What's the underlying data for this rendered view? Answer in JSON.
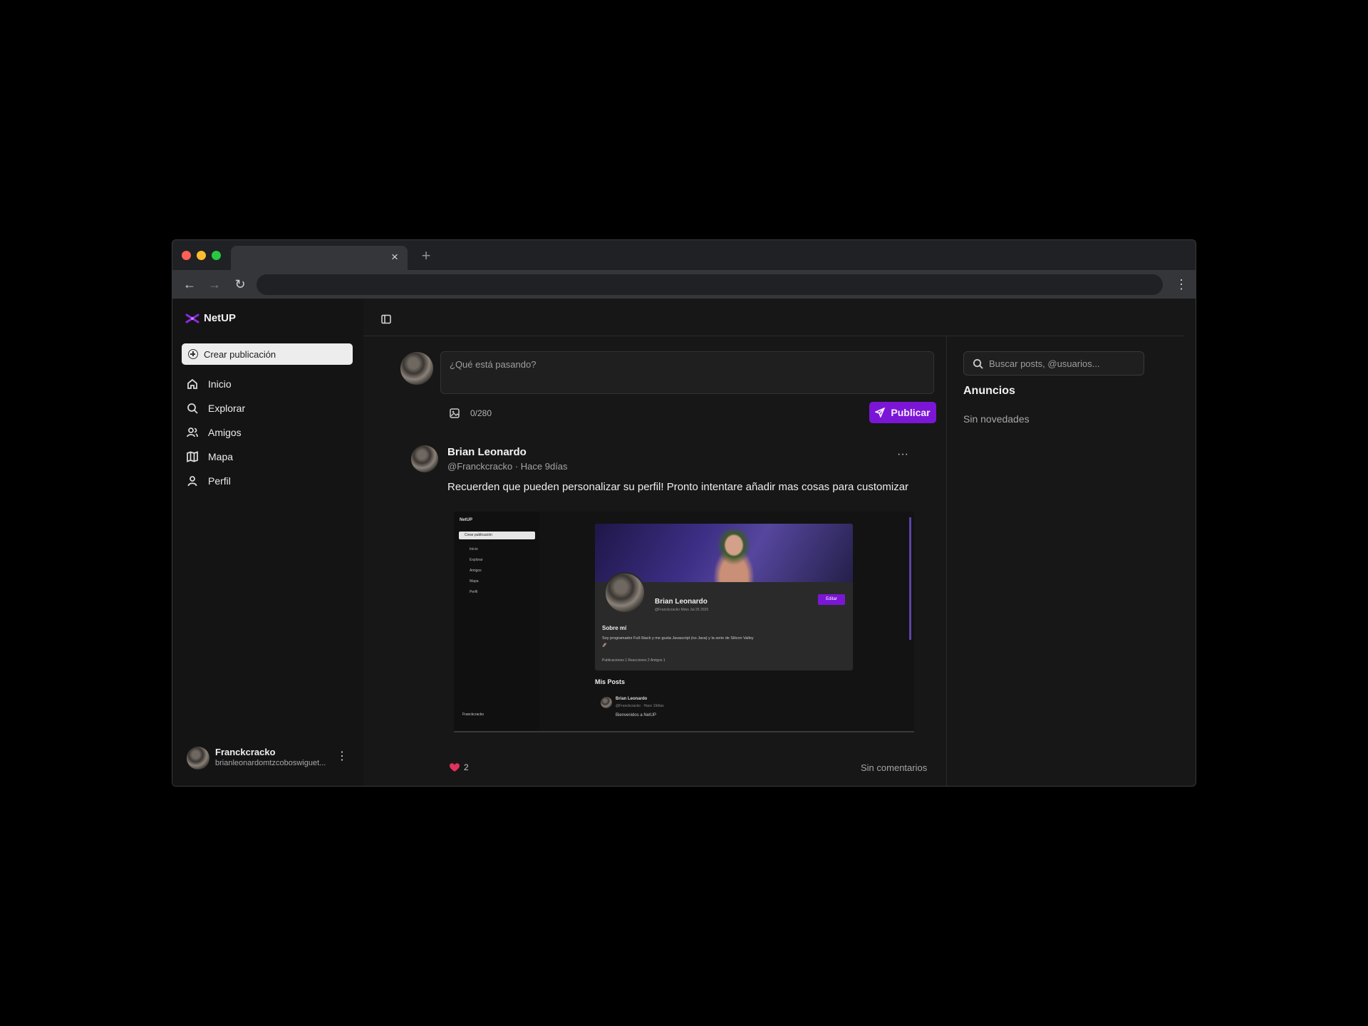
{
  "browser": {
    "tab_close": "×",
    "new_tab": "+",
    "menu": "⋮"
  },
  "sidebar": {
    "brand": "NetUP",
    "create_label": "Crear publicación",
    "items": [
      {
        "label": "Inicio",
        "icon": "home-icon"
      },
      {
        "label": "Explorar",
        "icon": "search-icon"
      },
      {
        "label": "Amigos",
        "icon": "users-icon"
      },
      {
        "label": "Mapa",
        "icon": "map-icon"
      },
      {
        "label": "Perfil",
        "icon": "user-icon"
      }
    ],
    "user": {
      "name": "Franckcracko",
      "email": "brianleonardomtzcoboswiguet..."
    }
  },
  "composer": {
    "placeholder": "¿Qué está pasando?",
    "char_count": "0/280",
    "publish_label": "Publicar"
  },
  "post": {
    "author": "Brian Leonardo",
    "meta": "@Franckcracko · Hace 9días",
    "more": "···",
    "text": "Recuerden que pueden personalizar su perfil! Pronto intentare añadir mas cosas para customizar",
    "likes": "2",
    "comments_label": "Sin comentarios",
    "image": {
      "brand": "NetUP",
      "create": "Crear publicación",
      "nav": [
        "Inicio",
        "Explorar",
        "Amigos",
        "Mapa",
        "Perfil"
      ],
      "user": "Franckcracko",
      "profile_name": "Brian Leonardo",
      "profile_handle": "@Franckcracko  Miws Jul 26 2025",
      "edit": "Editar",
      "about_title": "Sobre mí",
      "about_text": "Soy programador Full-Stack y me gusta Javascript (no Java) y la serie de Silicon Valley 🚀",
      "stats": "Publicaciones 1    Reacciones 2    Amigos 1",
      "section": "Mis Posts",
      "mini_post_name": "Brian Leonardo",
      "mini_post_meta": "@Franckcracko · Hace 19días",
      "mini_post_text": "Bienvenidos a NetUP"
    }
  },
  "right": {
    "search_placeholder": "Buscar posts, @usuarios...",
    "ads_title": "Anuncios",
    "ads_empty": "Sin novedades"
  },
  "colors": {
    "accent": "#7c16d6",
    "background": "#171717",
    "scroll_thumb": "#6a4fd0"
  }
}
